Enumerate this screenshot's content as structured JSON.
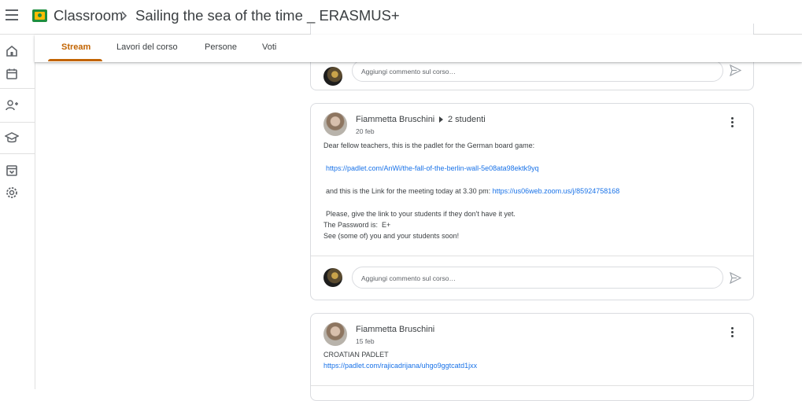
{
  "header": {
    "app_title": "Classroom",
    "course_title": "Sailing the sea of the time _ ERASMUS+"
  },
  "tabs": [
    {
      "label": "Stream",
      "active": true
    },
    {
      "label": "Lavori del corso",
      "active": false
    },
    {
      "label": "Persone",
      "active": false
    },
    {
      "label": "Voti",
      "active": false
    }
  ],
  "sidebar": {
    "icons": [
      "home-icon",
      "calendar-icon",
      "people-icon",
      "school-icon",
      "archive-icon",
      "settings-icon"
    ]
  },
  "comment_placeholder": "Aggiungi commento sul corso…",
  "posts": [
    {
      "author": "Fiammetta Bruschini",
      "audience": "2 studenti",
      "date": "20 feb",
      "lines": [
        "Dear fellow teachers, this is the padlet for the German board game:",
        "https://padlet.com/AnWi/the-fall-of-the-berlin-wall-5e08ata98ektk9yq",
        "and this is the Link for the meeting today at 3.30 pm: ",
        "https://us06web.zoom.us/j/85924758168",
        "Please, give the link to your students if they don't have it yet.",
        "The Password is:  E+",
        "See (some of) you and your students soon!"
      ]
    },
    {
      "author": "Fiammetta Bruschini",
      "date": "15 feb",
      "lines": [
        "CROATIAN PADLET",
        "https://padlet.com/rajicadrijana/uhgo9ggtcatd1jxx"
      ]
    }
  ],
  "colors": {
    "accent": "#c26401",
    "link": "#1a73e8",
    "text": "#3c4043"
  }
}
